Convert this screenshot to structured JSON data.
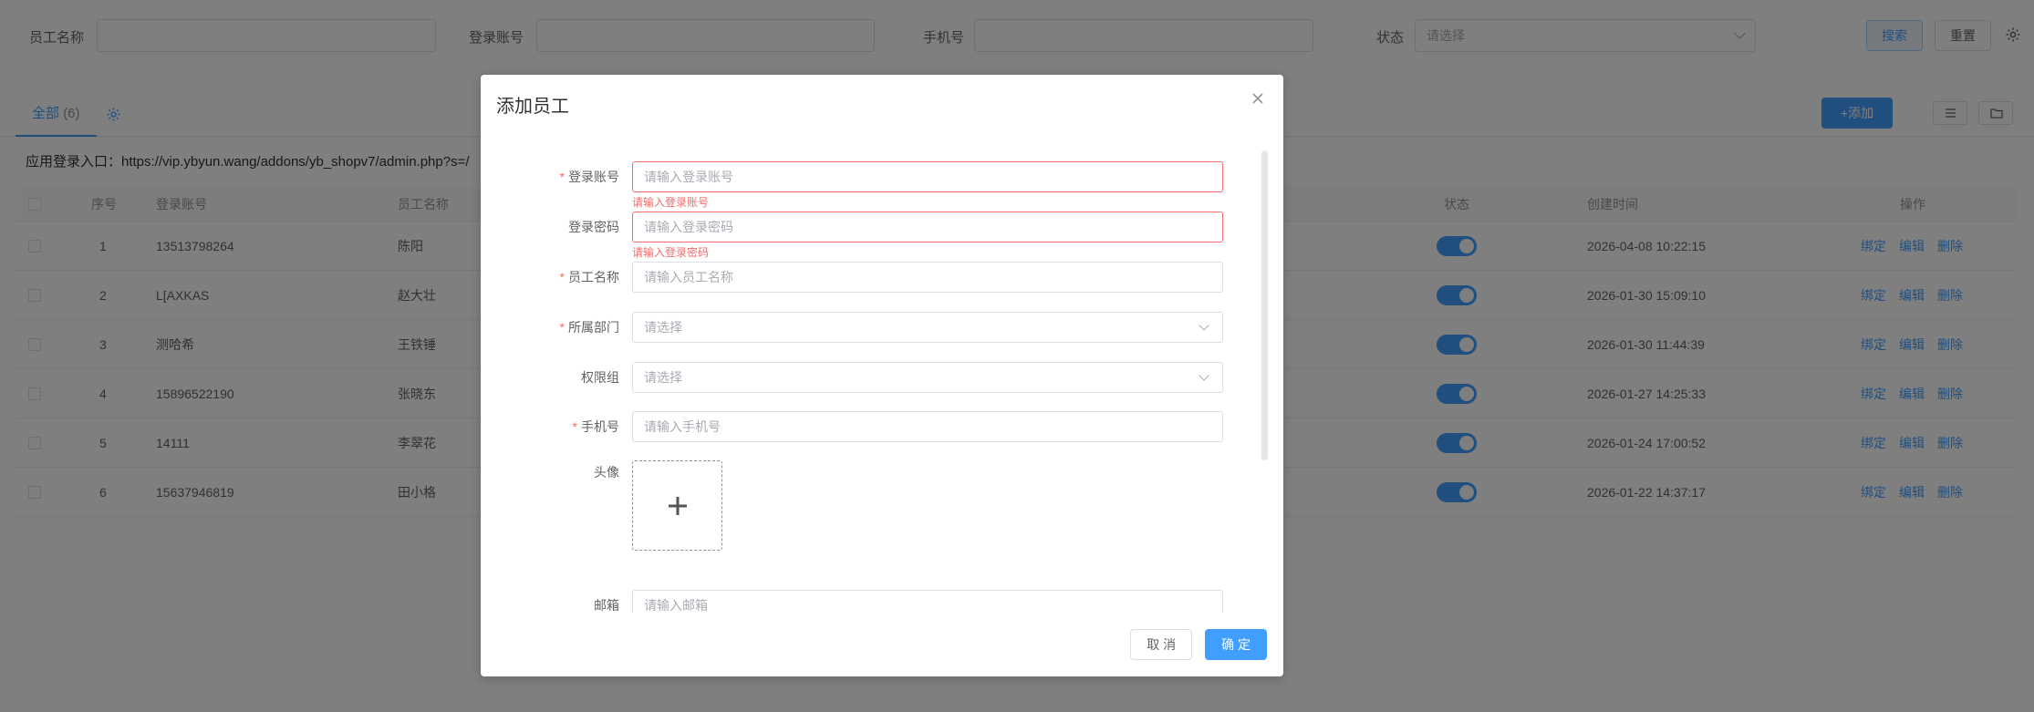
{
  "filters": {
    "name_label": "员工名称",
    "account_label": "登录账号",
    "phone_label": "手机号",
    "status_label": "状态",
    "status_placeholder": "请选择",
    "search_button": "搜索",
    "reset_button": "重置"
  },
  "tabs": {
    "all_label": "全部",
    "all_count": "(6)",
    "add_button": "+添加"
  },
  "entry_text": "应用登录入口：https://vip.ybyun.wang/addons/yb_shopv7/admin.php?s=/",
  "table": {
    "headers": {
      "index": "序号",
      "account": "登录账号",
      "name": "员工名称",
      "status": "状态",
      "created": "创建时间",
      "ops": "操作"
    },
    "rows": [
      {
        "index": "1",
        "account": "13513798264",
        "name": "陈阳",
        "created": "2026-04-08 10:22:15"
      },
      {
        "index": "2",
        "account": "L[AXKAS",
        "name": "赵大壮",
        "created": "2026-01-30 15:09:10"
      },
      {
        "index": "3",
        "account": "测哈希",
        "name": "王铁锤",
        "created": "2026-01-30 11:44:39"
      },
      {
        "index": "4",
        "account": "15896522190",
        "name": "张晓东",
        "created": "2026-01-27 14:25:33"
      },
      {
        "index": "5",
        "account": "14111",
        "name": "李翠花",
        "created": "2026-01-24 17:00:52"
      },
      {
        "index": "6",
        "account": "15637946819",
        "name": "田小格",
        "created": "2026-01-22 14:37:17"
      }
    ],
    "op_bind": "绑定",
    "op_edit": "编辑",
    "op_delete": "删除"
  },
  "dialog": {
    "title": "添加员工",
    "fields": {
      "account": {
        "label": "登录账号",
        "placeholder": "请输入登录账号",
        "error": "请输入登录账号"
      },
      "password": {
        "label": "登录密码",
        "placeholder": "请输入登录密码",
        "error": "请输入登录密码"
      },
      "name": {
        "label": "员工名称",
        "placeholder": "请输入员工名称"
      },
      "department": {
        "label": "所属部门",
        "placeholder": "请选择"
      },
      "permission": {
        "label": "权限组",
        "placeholder": "请选择"
      },
      "phone": {
        "label": "手机号",
        "placeholder": "请输入手机号"
      },
      "avatar": {
        "label": "头像"
      },
      "email": {
        "label": "邮箱",
        "placeholder": "请输入邮箱"
      }
    },
    "cancel_button": "取 消",
    "confirm_button": "确 定"
  },
  "colors": {
    "primary": "#409eff",
    "error": "#f56c6c",
    "overlay": "rgba(0,0,0,0.5)"
  }
}
